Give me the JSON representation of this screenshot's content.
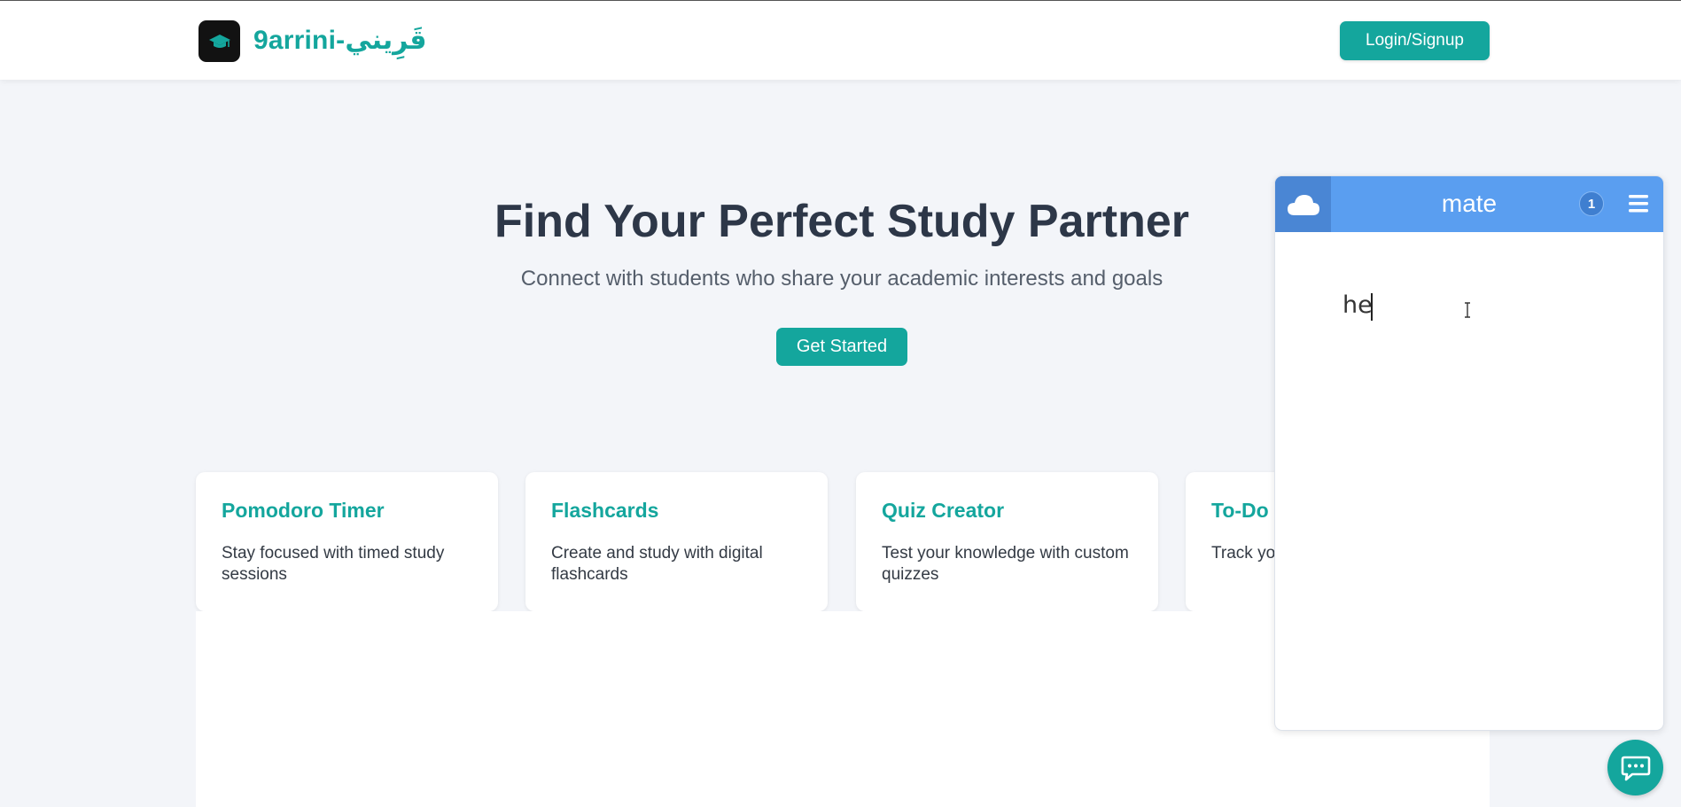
{
  "header": {
    "brand": "9arrini-قَرِيني",
    "login_label": "Login/Signup"
  },
  "hero": {
    "title": "Find Your Perfect Study Partner",
    "subtitle": "Connect with students who share your academic interests and goals",
    "cta_label": "Get Started"
  },
  "features": [
    {
      "title": "Pomodoro Timer",
      "description": "Stay focused with timed study sessions"
    },
    {
      "title": "Flashcards",
      "description": "Create and study with digital flashcards"
    },
    {
      "title": "Quiz Creator",
      "description": "Test your knowledge with custom quizzes"
    },
    {
      "title": "To-Do",
      "description": "Track your assignments"
    }
  ],
  "widget": {
    "title": "mate",
    "badge_count": "1",
    "input_text": "he"
  },
  "colors": {
    "accent": "#14a69d",
    "widget_header": "#5a9ef0",
    "background": "#f3f5f9"
  },
  "icons": {
    "logo": "graduation-cap-icon",
    "widget_logo": "cloud-icon",
    "widget_menu": "hamburger-menu-icon",
    "chat": "chat-bubble-icon"
  }
}
